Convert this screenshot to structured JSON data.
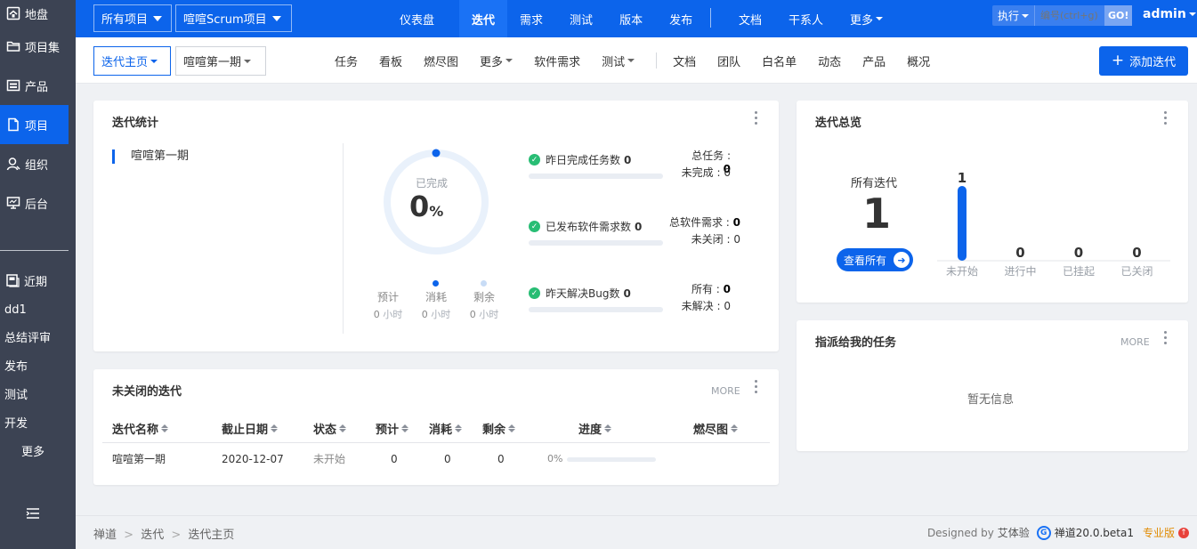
{
  "sidebar": {
    "items": [
      {
        "label": "地盘",
        "icon": "home-icon"
      },
      {
        "label": "项目集",
        "icon": "folder-icon"
      },
      {
        "label": "产品",
        "icon": "product-icon"
      },
      {
        "label": "项目",
        "icon": "file-icon",
        "active": true
      },
      {
        "label": "组织",
        "icon": "user-icon"
      },
      {
        "label": "后台",
        "icon": "monitor-icon"
      }
    ],
    "recent_label": "近期",
    "recent_items": [
      "dd1",
      "总结评审",
      "发布",
      "测试",
      "开发"
    ],
    "more_label": "更多"
  },
  "topbar": {
    "project_select": "所有项目",
    "current_project": "喧喧Scrum项目",
    "nav": [
      "仪表盘",
      "迭代",
      "需求",
      "测试",
      "版本",
      "发布"
    ],
    "nav_active": "迭代",
    "nav2": [
      "文档",
      "干系人",
      "更多"
    ],
    "search_type": "执行",
    "search_placeholder": "编号(ctrl+g)",
    "go_label": "GO!",
    "user": "admin"
  },
  "subbar": {
    "crumb1": "迭代主页",
    "crumb2": "喧喧第一期",
    "nav1": [
      "任务",
      "看板",
      "燃尽图",
      "更多",
      "软件需求",
      "测试"
    ],
    "nav2": [
      "文档",
      "团队",
      "白名单",
      "动态",
      "产品",
      "概况"
    ],
    "add_button": "添加迭代"
  },
  "stats_panel": {
    "title": "迭代统计",
    "execution_name": "喧喧第一期",
    "completed_label": "已完成",
    "completed_value": "0",
    "completed_unit": "%",
    "legend": [
      {
        "label": "预计",
        "value": "0",
        "unit": "小时"
      },
      {
        "label": "消耗",
        "value": "0",
        "unit": "小时"
      },
      {
        "label": "剩余",
        "value": "0",
        "unit": "小时"
      }
    ],
    "rows": [
      {
        "label": "昨日完成任务数",
        "value": "0",
        "right": [
          {
            "label": "总任务",
            "value": "0"
          },
          {
            "label": "未完成",
            "value": "0"
          }
        ]
      },
      {
        "label": "已发布软件需求数",
        "value": "0",
        "right": [
          {
            "label": "总软件需求",
            "value": "0"
          },
          {
            "label": "未关闭",
            "value": "0"
          }
        ]
      },
      {
        "label": "昨天解决Bug数",
        "value": "0",
        "right": [
          {
            "label": "所有",
            "value": "0"
          },
          {
            "label": "未解决",
            "value": "0"
          }
        ]
      }
    ]
  },
  "open_panel": {
    "title": "未关闭的迭代",
    "more": "MORE",
    "columns": [
      "迭代名称",
      "截止日期",
      "状态",
      "预计",
      "消耗",
      "剩余",
      "进度",
      "燃尽图"
    ],
    "rows": [
      {
        "name": "喧喧第一期",
        "end": "2020-12-07",
        "status": "未开始",
        "estimate": "0",
        "consumed": "0",
        "left": "0",
        "progress": "0%"
      }
    ]
  },
  "overview_panel": {
    "title": "迭代总览",
    "all_label": "所有迭代",
    "all_count": "1",
    "view_all": "查看所有",
    "chart_data": {
      "type": "bar",
      "categories": [
        "未开始",
        "进行中",
        "已挂起",
        "已关闭"
      ],
      "values": [
        1,
        0,
        0,
        0
      ],
      "color": "#0c64eb"
    }
  },
  "tasks_panel": {
    "title": "指派给我的任务",
    "more": "MORE",
    "empty": "暂无信息"
  },
  "footer": {
    "crumbs": [
      "禅道",
      "迭代",
      "迭代主页"
    ],
    "designed_by": "Designed by",
    "designer": "艾体验",
    "version": "禅道20.0.beta1",
    "edition": "专业版"
  }
}
